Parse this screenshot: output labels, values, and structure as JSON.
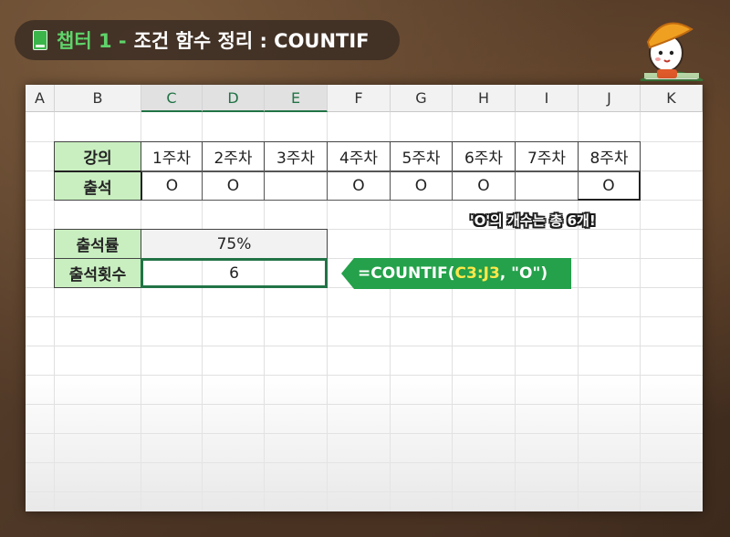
{
  "title": {
    "chapter": "챕터 1 -",
    "topic": "조건 함수 정리 : COUNTIF"
  },
  "columns": [
    "A",
    "B",
    "C",
    "D",
    "E",
    "F",
    "G",
    "H",
    "I",
    "J",
    "K"
  ],
  "attendance_table": {
    "row1_header": "강의",
    "weeks": [
      "1주차",
      "2주차",
      "3주차",
      "4주차",
      "5주차",
      "6주차",
      "7주차",
      "8주차"
    ],
    "row2_header": "출석",
    "marks": [
      "O",
      "O",
      "",
      "O",
      "O",
      "O",
      "",
      "O"
    ]
  },
  "summary": {
    "rate_label": "출석률",
    "rate_value": "75%",
    "count_label": "출석횟수",
    "count_value": "6"
  },
  "note": "'O'의 개수는 총 6개!",
  "formula": {
    "prefix": "=COUNTIF(",
    "range": "C3:J3",
    "suffix": ", \"O\")"
  },
  "colors": {
    "header_fill": "#c9efc0",
    "selection": "#217346",
    "formula_bg": "#24a14a",
    "title_accent": "#5fd36a"
  }
}
